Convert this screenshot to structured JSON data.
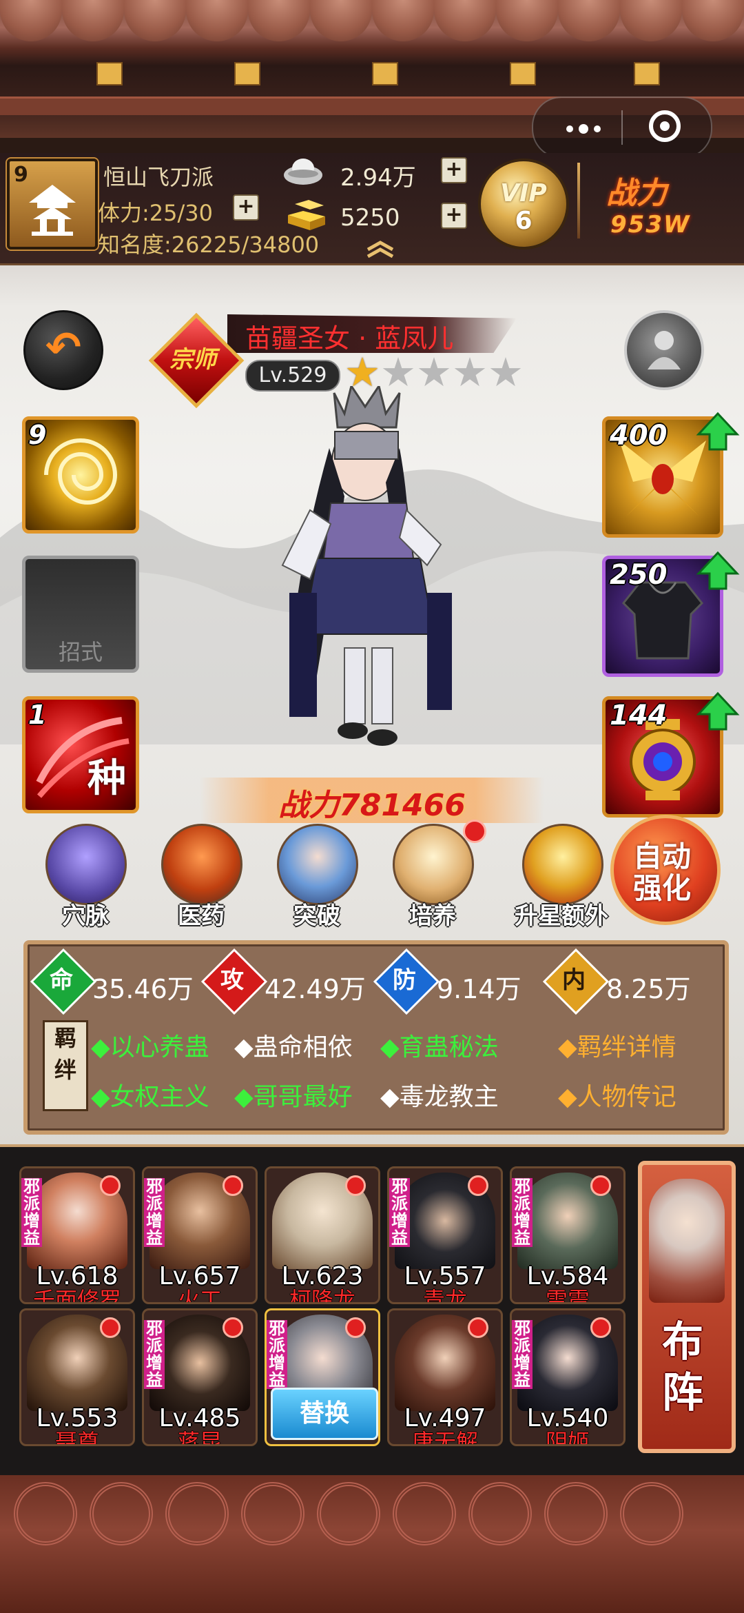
{
  "header": {
    "sect_level": "9",
    "sect_name": "恒山飞刀派",
    "stamina": "体力:25/30",
    "fame": "知名度:26225/34800",
    "silver": "2.94万",
    "gold": "5250",
    "vip_label": "VIP",
    "vip_level": "6",
    "power_label": "战力",
    "power_value": "953W"
  },
  "hero": {
    "rank": "宗师",
    "name": "苗疆圣女 · 蓝凤儿",
    "level": "Lv.529",
    "stars_filled": 1,
    "stars_total": 5,
    "combat_power": "战力781466"
  },
  "skills": [
    {
      "num": "9",
      "icon": "gold-swirl-icon"
    },
    {
      "label": "招式",
      "icon": "empty-slot"
    },
    {
      "num": "1",
      "char": "种",
      "icon": "red-seed-icon"
    }
  ],
  "gear": [
    {
      "num": "400",
      "icon": "golden-moth-icon"
    },
    {
      "num": "250",
      "icon": "black-armor-icon"
    },
    {
      "num": "144",
      "icon": "lantern-orb-icon"
    }
  ],
  "functions": [
    {
      "label": "穴脉",
      "icon": "meridian-icon",
      "dot": false
    },
    {
      "label": "医药",
      "icon": "mushroom-icon",
      "dot": false
    },
    {
      "label": "突破",
      "icon": "breakthrough-icon",
      "dot": false
    },
    {
      "label": "培养",
      "icon": "scroll-icon",
      "dot": true
    },
    {
      "label": "升星额外",
      "icon": "star-up-icon",
      "dot": false
    }
  ],
  "auto_enhance": "自动强化",
  "stats": [
    {
      "char": "命",
      "value": "35.46万",
      "color": "#1aa83a"
    },
    {
      "char": "攻",
      "value": "42.49万",
      "color": "#d41a1a"
    },
    {
      "char": "防",
      "value": "9.14万",
      "color": "#1a6ad4"
    },
    {
      "char": "内",
      "value": "8.25万",
      "color": "#e0a020"
    }
  ],
  "bonds": {
    "tag": "羁绊",
    "row1": [
      {
        "text": "◆以心养蛊",
        "active": true
      },
      {
        "text": "◆蛊命相依",
        "active": false
      },
      {
        "text": "◆育蛊秘法",
        "active": true
      }
    ],
    "row2": [
      {
        "text": "◆女权主义",
        "active": true
      },
      {
        "text": "◆哥哥最好",
        "active": true
      },
      {
        "text": "◆毒龙教主",
        "active": false
      }
    ],
    "detail_link": "◆羁绊详情",
    "bio_link": "◆人物传记"
  },
  "roster": [
    {
      "level": "Lv.618",
      "name": "千面修罗",
      "sect": "邪派增益"
    },
    {
      "level": "Lv.657",
      "name": "火工",
      "sect": "邪派增益"
    },
    {
      "level": "Lv.623",
      "name": "柯降龙",
      "sect": ""
    },
    {
      "level": "Lv.557",
      "name": "青龙",
      "sect": "邪派增益"
    },
    {
      "level": "Lv.584",
      "name": "雷震",
      "sect": "邪派增益"
    },
    {
      "level": "Lv.553",
      "name": "聂尊",
      "sect": ""
    },
    {
      "level": "Lv.485",
      "name": "蒋昆",
      "sect": "邪派增益"
    },
    {
      "level": "",
      "name": "",
      "sect": "邪派增益",
      "selected": true
    },
    {
      "level": "Lv.497",
      "name": "唐无解",
      "sect": ""
    },
    {
      "level": "Lv.540",
      "name": "阴姬",
      "sect": "邪派增益"
    }
  ],
  "replace_label": "替换",
  "formation_label": "布阵"
}
